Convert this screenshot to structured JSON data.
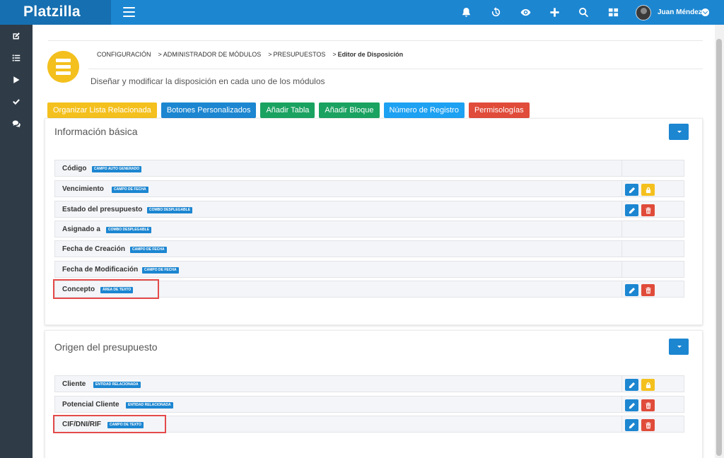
{
  "app": {
    "name": "Platzilla"
  },
  "user": {
    "name": "Juan Méndez"
  },
  "topbar": {
    "icons": [
      "bell-icon",
      "history-icon",
      "eye-icon",
      "plus-icon",
      "search-icon",
      "grid-icon"
    ]
  },
  "sidebar": {
    "icons": [
      "edit-icon",
      "list-icon",
      "play-icon",
      "check-icon",
      "chat-icon"
    ]
  },
  "breadcrumb": {
    "items": [
      "CONFIGURACIÓN",
      "ADMINISTRADOR DE MÓDULOS",
      "PRESUPUESTOS",
      "Editor de Disposición"
    ],
    "separator": ">"
  },
  "subtitle": "Diseñar y modificar la disposición en cada uno de los módulos",
  "tabs": [
    {
      "label": "Organizar Lista Relacionada",
      "color": "#f4c01e"
    },
    {
      "label": "Botones Personalizados",
      "color": "#1c86d1"
    },
    {
      "label": "Añadir Tabla",
      "color": "#1aa260"
    },
    {
      "label": "Añadir Bloque",
      "color": "#1aa260"
    },
    {
      "label": "Número de Registro",
      "color": "#1da1f2"
    },
    {
      "label": "Permisologías",
      "color": "#e04b3a"
    }
  ],
  "blocks": [
    {
      "title": "Información básica",
      "fields": [
        {
          "name": "Código",
          "badge": "CAMPO AUTO GENERADO",
          "actions": []
        },
        {
          "name": "Vencimiento",
          "badge": "CAMPO DE FECHA",
          "actions": [
            "edit",
            "lock"
          ]
        },
        {
          "name": "Estado del presupuesto",
          "badge": "COMBO DESPLEGABLE",
          "actions": [
            "edit",
            "delete"
          ]
        },
        {
          "name": "Asignado a",
          "badge": "COMBO DESPLEGABLE",
          "actions": []
        },
        {
          "name": "Fecha de Creación",
          "badge": "CAMPO DE FECHA",
          "actions": []
        },
        {
          "name": "Fecha de Modificación",
          "badge": "CAMPO DE FECHA",
          "actions": []
        },
        {
          "name": "Concepto",
          "badge": "ÁREA DE TEXTO",
          "actions": [
            "edit",
            "delete"
          ],
          "highlighted": true
        }
      ]
    },
    {
      "title": "Origen del presupuesto",
      "fields": [
        {
          "name": "Cliente",
          "badge": "ENTIDAD RELACIONADA",
          "actions": [
            "edit",
            "lock"
          ]
        },
        {
          "name": "Potencial Cliente",
          "badge": "ENTIDAD RELACIONADA",
          "actions": [
            "edit",
            "delete"
          ]
        },
        {
          "name": "CIF/DNI/RIF",
          "badge": "CAMPO DE TEXTO",
          "actions": [
            "edit",
            "delete"
          ],
          "highlighted": true
        }
      ]
    }
  ],
  "colors": {
    "brand": "#1c86d1",
    "sidebar": "#2f3c48",
    "highlight": "#e44a4a",
    "warning": "#f4c01e",
    "danger": "#e04b3a"
  }
}
